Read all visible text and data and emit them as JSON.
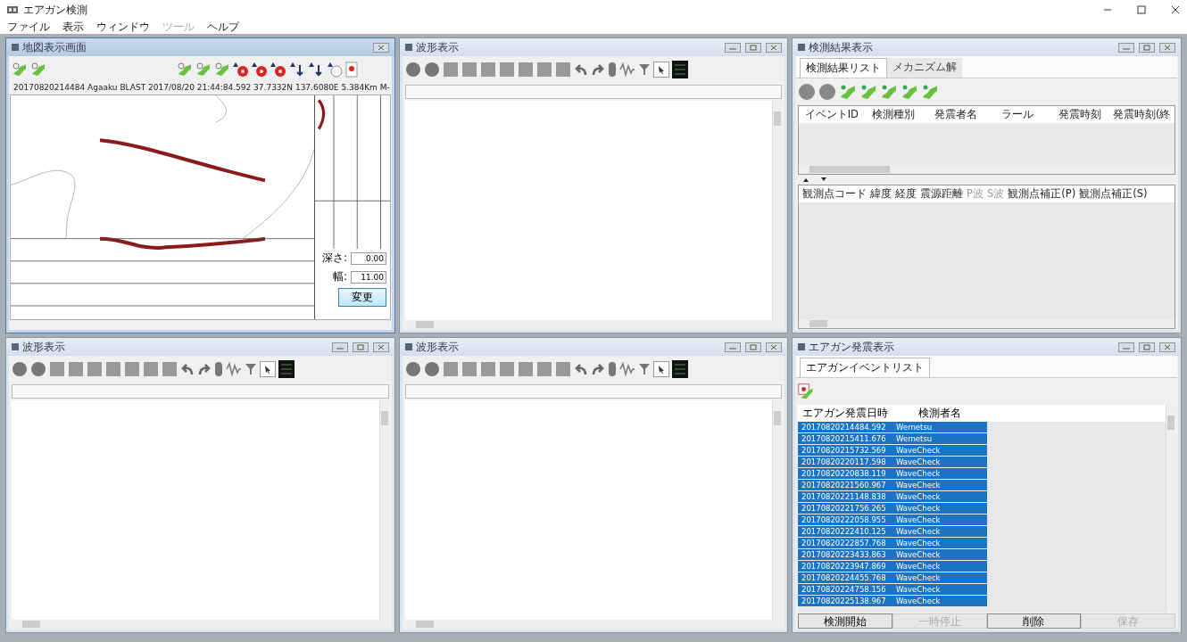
{
  "window": {
    "title": "エアガン検測"
  },
  "menu": [
    {
      "label": "ファイル",
      "disabled": false
    },
    {
      "label": "表示",
      "disabled": false
    },
    {
      "label": "ウィンドウ",
      "disabled": false
    },
    {
      "label": "ツール",
      "disabled": true
    },
    {
      "label": "ヘルプ",
      "disabled": false
    }
  ],
  "map_panel": {
    "title": "地図表示画面",
    "status": "20170820214484 Agaaku BLAST   2017/08/20 21:44:84.592 37.7332N 137.6080E 5.384Km M-",
    "depth_label": "深さ:",
    "depth_value": "0.00",
    "width_label": "幅:",
    "width_value": "11.00",
    "apply_button": "変更"
  },
  "wave_panels": [
    {
      "title": "波形表示"
    },
    {
      "title": "波形表示"
    },
    {
      "title": "波形表示"
    }
  ],
  "results_panel": {
    "title": "検測結果表示",
    "tabs": [
      {
        "label": "検測結果リスト",
        "selected": true
      },
      {
        "label": "メカニズム解",
        "selected": false
      }
    ],
    "event_columns": [
      "イベントID",
      "検測種別",
      "発震者名",
      "ラール",
      "発震時刻",
      "発震時刻(終"
    ],
    "station_columns": [
      {
        "label": "観測点コード",
        "disabled": false
      },
      {
        "label": "緯度",
        "disabled": false
      },
      {
        "label": "経度",
        "disabled": false
      },
      {
        "label": "震源距離",
        "disabled": false
      },
      {
        "label": "P波",
        "disabled": true
      },
      {
        "label": "S波",
        "disabled": true
      },
      {
        "label": "観測点補正(P)",
        "disabled": false
      },
      {
        "label": "観測点補正(S)",
        "disabled": false
      }
    ]
  },
  "airgun_panel": {
    "title": "エアガン発震表示",
    "tabs": [
      {
        "label": "エアガンイベントリスト",
        "selected": true
      }
    ],
    "columns": [
      "エアガン発震日時",
      "検測者名"
    ],
    "rows": [
      {
        "time": "20170820214484.592",
        "operator": "Wernetsu",
        "selected": true
      },
      {
        "time": "20170820215411.676",
        "operator": "Wernetsu",
        "selected": true
      },
      {
        "time": "20170820215732.569",
        "operator": "WaveCheck",
        "selected": true
      },
      {
        "time": "20170820220117.598",
        "operator": "WaveCheck",
        "selected": true
      },
      {
        "time": "20170820220838.119",
        "operator": "WaveCheck",
        "selected": true
      },
      {
        "time": "20170820221560.967",
        "operator": "WaveCheck",
        "selected": true
      },
      {
        "time": "20170820221148.838",
        "operator": "WaveCheck",
        "selected": true
      },
      {
        "time": "20170820221756.265",
        "operator": "WaveCheck",
        "selected": true
      },
      {
        "time": "20170820222058.955",
        "operator": "WaveCheck",
        "selected": true
      },
      {
        "time": "20170820222410.125",
        "operator": "WaveCheck",
        "selected": true
      },
      {
        "time": "20170820222857.768",
        "operator": "WaveCheck",
        "selected": true
      },
      {
        "time": "20170820223433.863",
        "operator": "WaveCheck",
        "selected": true
      },
      {
        "time": "20170820223947.869",
        "operator": "WaveCheck",
        "selected": true
      },
      {
        "time": "20170820224455.768",
        "operator": "WaveCheck",
        "selected": true
      },
      {
        "time": "20170820224758.156",
        "operator": "WaveCheck",
        "selected": true
      },
      {
        "time": "20170820225138.967",
        "operator": "WaveCheck",
        "selected": true
      }
    ],
    "buttons": [
      {
        "label": "検測開始",
        "disabled": false
      },
      {
        "label": "一時停止",
        "disabled": true
      },
      {
        "label": "削除",
        "disabled": false
      },
      {
        "label": "保存",
        "disabled": true
      }
    ]
  }
}
